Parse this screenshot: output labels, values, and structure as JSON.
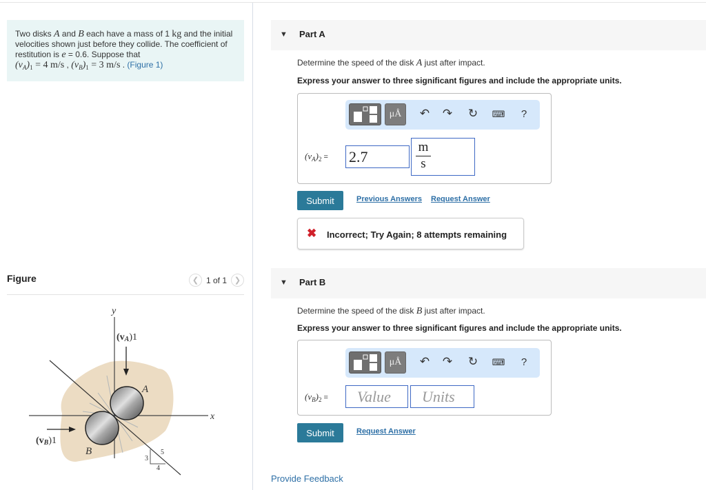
{
  "problem": {
    "text_1": "Two disks ",
    "disk_a": "A",
    "text_2": " and ",
    "disk_b": "B",
    "text_3": " each have a mass of 1 ",
    "mass_unit": "kg",
    "text_4": " and the initial velocities shown just before they collide. The coefficient of restitution is ",
    "e_symbol": "e",
    "text_5": " = 0.6. Suppose that",
    "va1_label": "(v",
    "va1_sub": "A",
    "va1_close": ")",
    "va1_idx": "1",
    "va1_value": " = 4  m/s",
    "sep": " , ",
    "vb1_label": "(v",
    "vb1_sub": "B",
    "vb1_close": ")",
    "vb1_idx": "1",
    "vb1_value": " = 3  m/s",
    "end": " . ",
    "figure_link": "(Figure 1)"
  },
  "figure": {
    "title": "Figure",
    "pager": "1 of 1",
    "prev_icon": "chevron-left-icon",
    "next_icon": "chevron-right-icon",
    "labels": {
      "y": "y",
      "x": "x",
      "va1": "(v",
      "va1_sub": "A",
      "va1_tail": ")1",
      "vb1": "(v",
      "vb1_sub": "B",
      "vb1_tail": ")1",
      "disk_a": "A",
      "disk_b": "B",
      "tri_3": "3",
      "tri_4": "4",
      "tri_5": "5"
    }
  },
  "toolbar": {
    "templates_icon": "fraction-template-icon",
    "units_label": "μÅ",
    "undo_icon": "undo-icon",
    "redo_icon": "redo-icon",
    "reset_icon": "reset-icon",
    "keyboard_icon": "keyboard-icon",
    "help_label": "?"
  },
  "parts": [
    {
      "label": "Part A",
      "question_1": "Determine the speed of the disk ",
      "disk": "A",
      "question_2": " just after impact.",
      "instruction": "Express your answer to three significant figures and include the appropriate units.",
      "eq_var": "(v",
      "eq_sub": "A",
      "eq_close": ")",
      "eq_idx": "2",
      "eq_sign": " =",
      "value": "2.7",
      "unit_num": "m",
      "unit_den": "s",
      "submit": "Submit",
      "previous_answers": "Previous Answers",
      "request_answer": "Request Answer",
      "feedback": "Incorrect; Try Again; 8 attempts remaining"
    },
    {
      "label": "Part B",
      "question_1": "Determine the speed of the disk ",
      "disk": "B",
      "question_2": " just after impact.",
      "instruction": "Express your answer to three significant figures and include the appropriate units.",
      "eq_var": "(v",
      "eq_sub": "B",
      "eq_close": ")",
      "eq_idx": "2",
      "eq_sign": " =",
      "value_placeholder": "Value",
      "units_placeholder": "Units",
      "submit": "Submit",
      "request_answer": "Request Answer"
    }
  ],
  "footer": {
    "provide_feedback": "Provide Feedback"
  },
  "colors": {
    "accent": "#2b7a99",
    "link": "#2d6fa6",
    "error": "#d0202a",
    "problem_bg": "#e9f5f5",
    "toolbar_bg": "#d6e8fb"
  }
}
